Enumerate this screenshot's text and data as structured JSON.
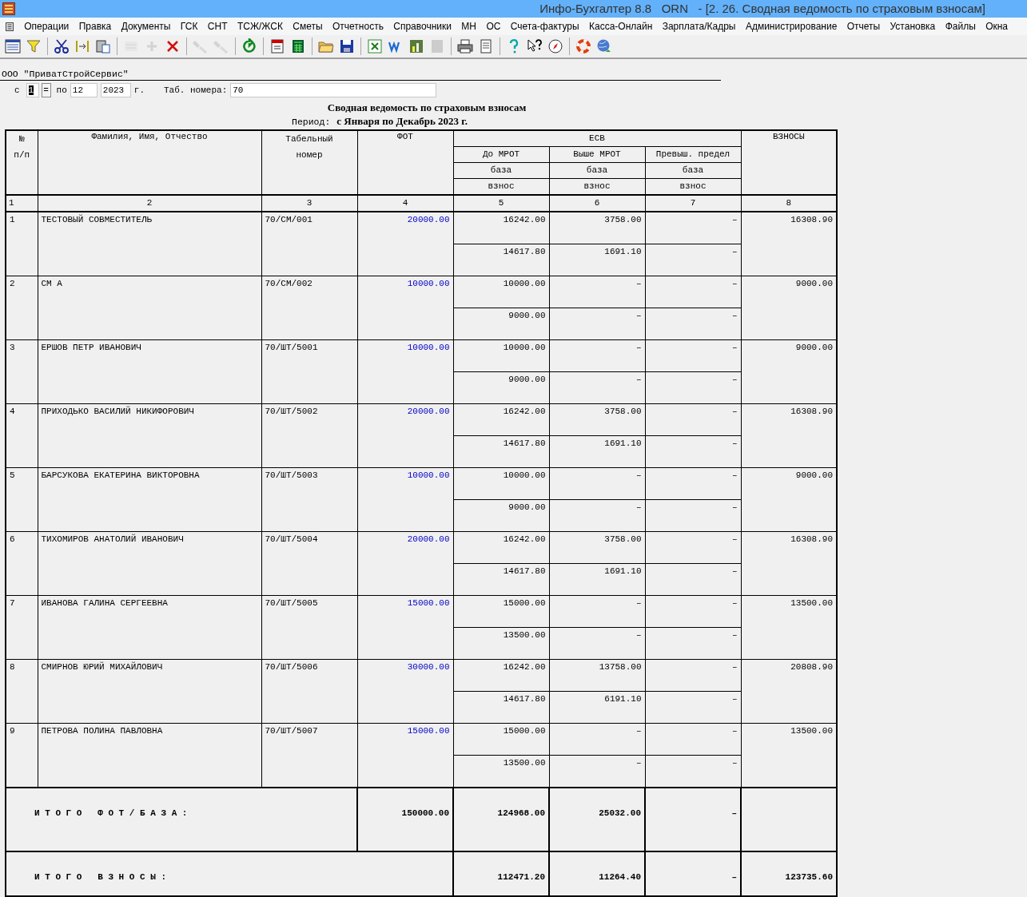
{
  "window": {
    "title": "Инфо-Бухгалтер 8.8   ORN   - [2. 26. Сводная ведомость по страховым взносам]"
  },
  "menu": [
    "Операции",
    "Правка",
    "Документы",
    "ГСК",
    "СНТ",
    "ТСЖ/ЖСК",
    "Сметы",
    "Отчетность",
    "Справочники",
    "МН",
    "ОС",
    "Счета-фактуры",
    "Касса-Онлайн",
    "Зарплата/Кадры",
    "Администрирование",
    "Отчеты",
    "Установка",
    "Файлы",
    "Окна"
  ],
  "toolbar": [
    {
      "kind": "grid",
      "disabled": false
    },
    {
      "kind": "filter",
      "disabled": false
    },
    {
      "kind": "separator"
    },
    {
      "kind": "scissors",
      "disabled": false
    },
    {
      "kind": "merge",
      "disabled": false
    },
    {
      "kind": "paste",
      "disabled": false
    },
    {
      "kind": "separator"
    },
    {
      "kind": "numbers",
      "disabled": true
    },
    {
      "kind": "plus",
      "disabled": true
    },
    {
      "kind": "delete",
      "disabled": false
    },
    {
      "kind": "separator"
    },
    {
      "kind": "flashlight",
      "disabled": true
    },
    {
      "kind": "flashlight",
      "disabled": true
    },
    {
      "kind": "separator"
    },
    {
      "kind": "refresh",
      "disabled": false
    },
    {
      "kind": "separator"
    },
    {
      "kind": "calendar",
      "disabled": false
    },
    {
      "kind": "calculator",
      "disabled": false
    },
    {
      "kind": "separator"
    },
    {
      "kind": "folder",
      "disabled": false
    },
    {
      "kind": "save",
      "disabled": false
    },
    {
      "kind": "separator"
    },
    {
      "kind": "sheet",
      "disabled": false
    },
    {
      "kind": "word",
      "disabled": false
    },
    {
      "kind": "chart",
      "disabled": false
    },
    {
      "kind": "blank",
      "disabled": true
    },
    {
      "kind": "separator"
    },
    {
      "kind": "printer",
      "disabled": false
    },
    {
      "kind": "page",
      "disabled": false
    },
    {
      "kind": "separator"
    },
    {
      "kind": "help",
      "disabled": false
    },
    {
      "kind": "pointer-help",
      "disabled": false
    },
    {
      "kind": "compass",
      "disabled": false
    },
    {
      "kind": "separator"
    },
    {
      "kind": "lifebuoy",
      "disabled": false
    },
    {
      "kind": "globe",
      "disabled": false
    }
  ],
  "company": "ООО \"ПриватСтройСервис\"",
  "filter": {
    "from_label": "с",
    "from": {
      "value": "1",
      "highlighted": true
    },
    "equals": "=",
    "to_label": "по",
    "to": "12",
    "year": "2023",
    "year_suffix": "г.",
    "tab_label": "Таб. номера:",
    "tab_value": "70"
  },
  "report": {
    "title": "Сводная ведомость по страховым взносам",
    "period_label": "Период:",
    "period": "с Января по Декабрь 2023 г."
  },
  "table": {
    "header": {
      "num": [
        "№",
        "п/п"
      ],
      "name": "Фамилия, Имя, Отчество",
      "tab": [
        "Табельный",
        "номер"
      ],
      "fot": "ФОТ",
      "esv": "ЕСВ",
      "esv_columns": [
        "До МРОТ",
        "Выше МРОТ",
        "Превыш. предел"
      ],
      "base": [
        "база",
        "база",
        "база"
      ],
      "contrib": [
        "взнос",
        "взнос",
        "взнос"
      ],
      "total": "ВЗНОСЫ"
    },
    "index": [
      "1",
      "2",
      "3",
      "4",
      "5",
      "6",
      "7",
      "8"
    ],
    "rows": [
      {
        "num": "1",
        "name": "ТЕСТОВЫЙ СОВМЕСТИТЕЛЬ",
        "tab": "70/СМ/001",
        "fot": "20000.00",
        "base": [
          "16242.00",
          "3758.00",
          "–"
        ],
        "contrib": [
          "14617.80",
          "1691.10",
          "–"
        ],
        "total": "16308.90"
      },
      {
        "num": "2",
        "name": "СМ А",
        "tab": "70/СМ/002",
        "fot": "10000.00",
        "base": [
          "10000.00",
          "–",
          "–"
        ],
        "contrib": [
          "9000.00",
          "–",
          "–"
        ],
        "total": "9000.00"
      },
      {
        "num": "3",
        "name": "ЕРШОВ ПЕТР ИВАНОВИЧ",
        "tab": "70/ШТ/5001",
        "fot": "10000.00",
        "base": [
          "10000.00",
          "–",
          "–"
        ],
        "contrib": [
          "9000.00",
          "–",
          "–"
        ],
        "total": "9000.00"
      },
      {
        "num": "4",
        "name": "ПРИХОДЬКО ВАСИЛИЙ НИКИФОРОВИЧ",
        "tab": "70/ШТ/5002",
        "fot": "20000.00",
        "base": [
          "16242.00",
          "3758.00",
          "–"
        ],
        "contrib": [
          "14617.80",
          "1691.10",
          "–"
        ],
        "total": "16308.90"
      },
      {
        "num": "5",
        "name": "БАРСУКОВА ЕКАТЕРИНА ВИКТОРОВНА",
        "tab": "70/ШТ/5003",
        "fot": "10000.00",
        "base": [
          "10000.00",
          "–",
          "–"
        ],
        "contrib": [
          "9000.00",
          "–",
          "–"
        ],
        "total": "9000.00"
      },
      {
        "num": "6",
        "name": "ТИХОМИРОВ АНАТОЛИЙ ИВАНОВИЧ",
        "tab": "70/ШТ/5004",
        "fot": "20000.00",
        "base": [
          "16242.00",
          "3758.00",
          "–"
        ],
        "contrib": [
          "14617.80",
          "1691.10",
          "–"
        ],
        "total": "16308.90"
      },
      {
        "num": "7",
        "name": "ИВАНОВА ГАЛИНА СЕРГЕЕВНА",
        "tab": "70/ШТ/5005",
        "fot": "15000.00",
        "base": [
          "15000.00",
          "–",
          "–"
        ],
        "contrib": [
          "13500.00",
          "–",
          "–"
        ],
        "total": "13500.00"
      },
      {
        "num": "8",
        "name": "СМИРНОВ ЮРИЙ МИХАЙЛОВИЧ",
        "tab": "70/ШТ/5006",
        "fot": "30000.00",
        "base": [
          "16242.00",
          "13758.00",
          "–"
        ],
        "contrib": [
          "14617.80",
          "6191.10",
          "–"
        ],
        "total": "20808.90"
      },
      {
        "num": "9",
        "name": "ПЕТРОВА ПОЛИНА ПАВЛОВНА",
        "tab": "70/ШТ/5007",
        "fot": "15000.00",
        "base": [
          "15000.00",
          "–",
          "–"
        ],
        "contrib": [
          "13500.00",
          "–",
          "–"
        ],
        "total": "13500.00"
      }
    ],
    "total_base": {
      "label": "И Т О Г О   Ф О Т / Б А З А :",
      "fot": "150000.00",
      "values": [
        "124968.00",
        "25032.00",
        "–"
      ]
    },
    "total_contrib": {
      "label": "И Т О Г О   В З Н О С Ы :",
      "values": [
        "112471.20",
        "11264.40",
        "–"
      ],
      "total": "123735.60"
    }
  }
}
